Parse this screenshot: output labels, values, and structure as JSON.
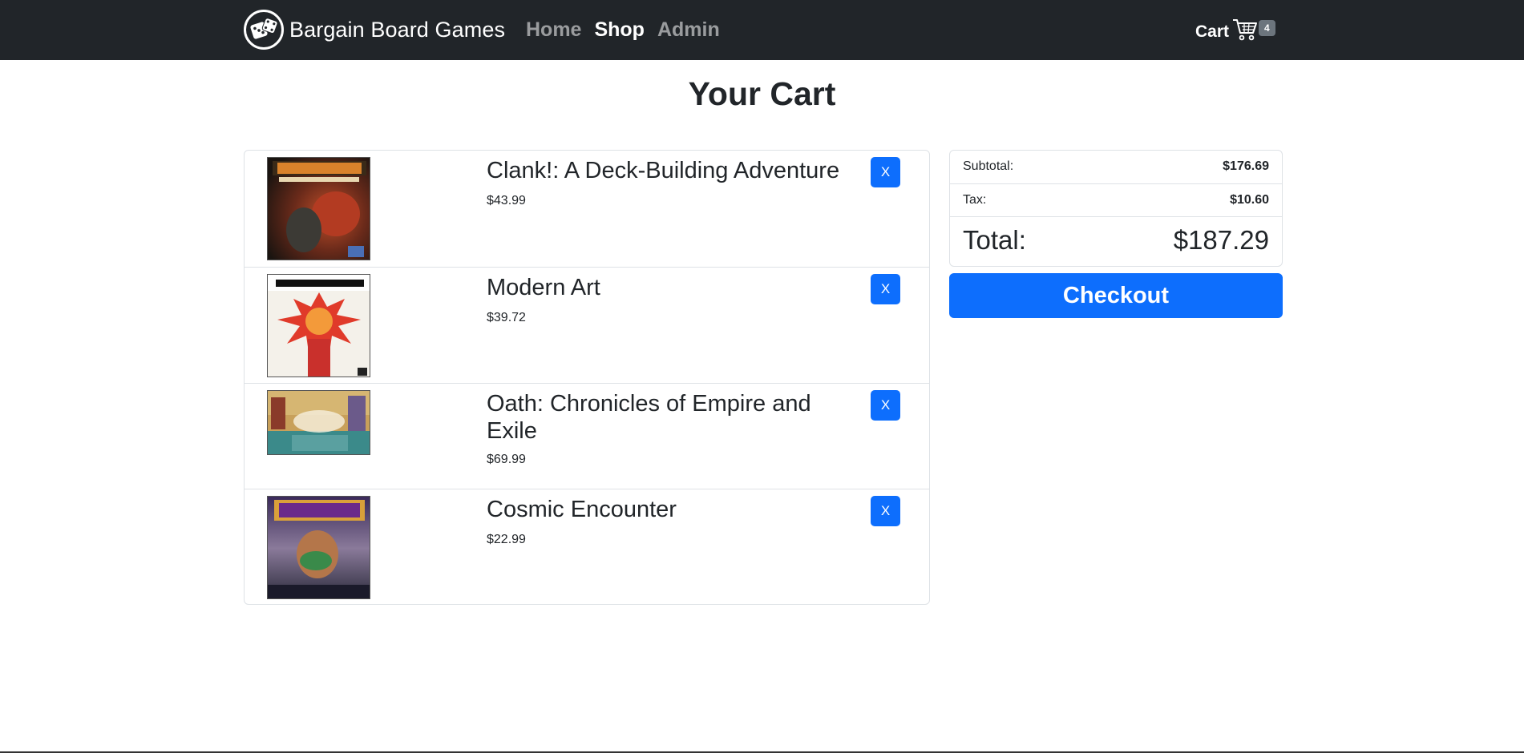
{
  "navbar": {
    "brand": "Bargain Board Games",
    "links": [
      {
        "label": "Home",
        "active": false
      },
      {
        "label": "Shop",
        "active": true
      },
      {
        "label": "Admin",
        "active": false
      }
    ],
    "cart_label": "Cart",
    "cart_count": "4",
    "brand_icon": "dice-icon",
    "cart_icon": "shopping-cart-icon"
  },
  "page": {
    "title": "Your Cart"
  },
  "cart": {
    "items": [
      {
        "name": "Clank!: A Deck-Building Adventure",
        "price": "$43.99",
        "remove_label": "X",
        "image_icon": "clank-box-art"
      },
      {
        "name": "Modern Art",
        "price": "$39.72",
        "remove_label": "X",
        "image_icon": "modern-art-box-art"
      },
      {
        "name": "Oath: Chronicles of Empire and Exile",
        "price": "$69.99",
        "remove_label": "X",
        "image_icon": "oath-box-art"
      },
      {
        "name": "Cosmic Encounter",
        "price": "$22.99",
        "remove_label": "X",
        "image_icon": "cosmic-encounter-box-art"
      }
    ]
  },
  "summary": {
    "subtotal_label": "Subtotal:",
    "subtotal_value": "$176.69",
    "tax_label": "Tax:",
    "tax_value": "$10.60",
    "total_label": "Total:",
    "total_value": "$187.29",
    "checkout_label": "Checkout"
  },
  "colors": {
    "navbar_bg": "#212529",
    "primary": "#0d6efd",
    "badge": "#6c757d",
    "border": "#dee2e6"
  }
}
